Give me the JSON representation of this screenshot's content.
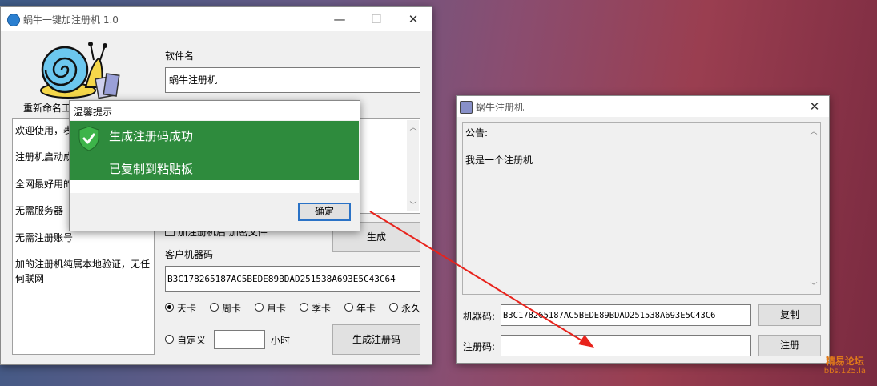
{
  "main_window": {
    "title": "蜗牛一键加注册机 1.0",
    "minimize": "—",
    "maximize": "☐",
    "close": "✕",
    "rename_label": "重新命名工",
    "software_name_label": "软件名",
    "software_name_value": "蜗牛注册机",
    "log_lines": [
      "欢迎使用，表",
      "注册机启动成",
      "全网最好用的",
      "无需服务器",
      "无需注册账号",
      "加的注册机纯属本地验证，无任",
      "何联网"
    ],
    "encrypt_checkbox_label": "加注册机后 加密文件",
    "generate_button": "生成",
    "machine_code_label": "客户机器码",
    "machine_code_value": "B3C178265187AC5BEDE89BDAD251538A693E5C43C64",
    "durations": [
      {
        "label": "天卡",
        "checked": true
      },
      {
        "label": "周卡",
        "checked": false
      },
      {
        "label": "月卡",
        "checked": false
      },
      {
        "label": "季卡",
        "checked": false
      },
      {
        "label": "年卡",
        "checked": false
      },
      {
        "label": "永久",
        "checked": false
      }
    ],
    "custom_label": "自定义",
    "custom_hours_value": "",
    "hours_label": "小时",
    "generate_code_button": "生成注册码"
  },
  "dialog": {
    "title": "温馨提示",
    "line1": "生成注册码成功",
    "line2": "已复制到粘贴板",
    "ok_button": "确定",
    "success_color": "#2e8b3d"
  },
  "reg_window": {
    "title": "蜗牛注册机",
    "close": "✕",
    "notice_label": "公告:",
    "notice_text": "我是一个注册机",
    "machine_code_label": "机器码:",
    "machine_code_value": "B3C178265187AC5BEDE89BDAD251538A693E5C43C6",
    "copy_button": "复制",
    "reg_code_label": "注册码:",
    "reg_code_value": "",
    "register_button": "注册"
  },
  "watermark": {
    "line1": "精易论坛",
    "line2": "bbs.125.la"
  }
}
